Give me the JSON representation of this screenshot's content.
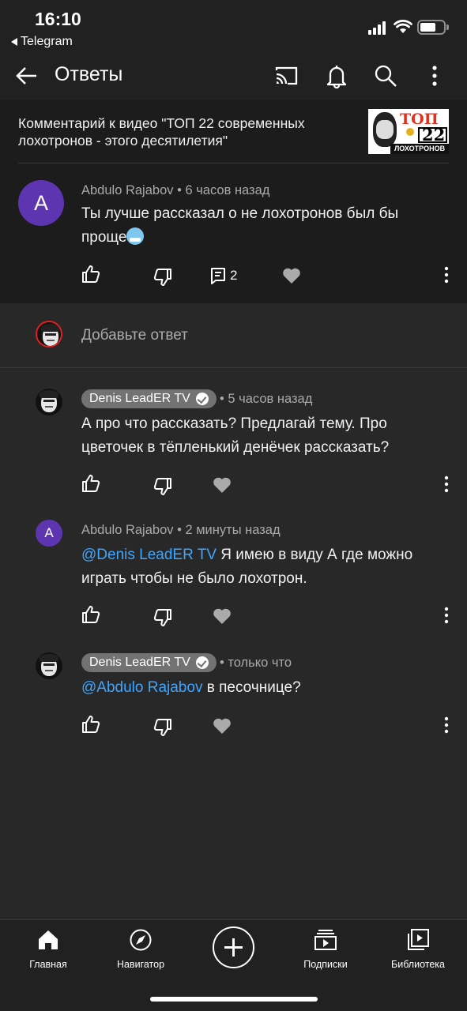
{
  "status_bar": {
    "time": "16:10",
    "back_app": "Telegram"
  },
  "header": {
    "title": "Ответы",
    "icons": [
      "back-arrow-icon",
      "cast-icon",
      "bell-icon",
      "search-icon",
      "more-vertical-icon"
    ]
  },
  "video_context": {
    "text": "Комментарий к видео \"ТОП 22 современных лохотронов - этого десятилетия\"",
    "thumb_top": "ТОП",
    "thumb_num": "22",
    "thumb_bottom": "ЛОХОТРОНОВ"
  },
  "original_comment": {
    "avatar_letter": "A",
    "author": "Abdulo Rajabov",
    "time": "• 6 часов назад",
    "text": "Ты лучше рассказал о не лохотронов был бы проще",
    "reply_count": "2"
  },
  "add_reply": {
    "placeholder": "Добавьте ответ"
  },
  "replies": [
    {
      "author": "Denis LeadER TV",
      "verified": true,
      "time": "• 5 часов назад",
      "mention": "",
      "text": "А про что рассказать? Предлагай тему. Про цветочек в тёпленький денёчек рассказать?"
    },
    {
      "author": "Abdulo Rajabov",
      "avatar_letter": "A",
      "time": "• 2 минуты назад",
      "mention": "@Denis LeadER TV",
      "text": " Я имею в виду А где можно играть чтобы не было лохотрон."
    },
    {
      "author": "Denis LeadER TV",
      "verified": true,
      "time": "• только что",
      "mention": "@Abdulo Rajabov",
      "text": " в песочнице?"
    }
  ],
  "bottom_nav": {
    "home": "Главная",
    "explore": "Навигатор",
    "subscriptions": "Подписки",
    "library": "Библиотека"
  },
  "colors": {
    "background": "#282828",
    "header": "#212121",
    "link": "#3ea6ff",
    "avatar": "#5e35b1"
  }
}
